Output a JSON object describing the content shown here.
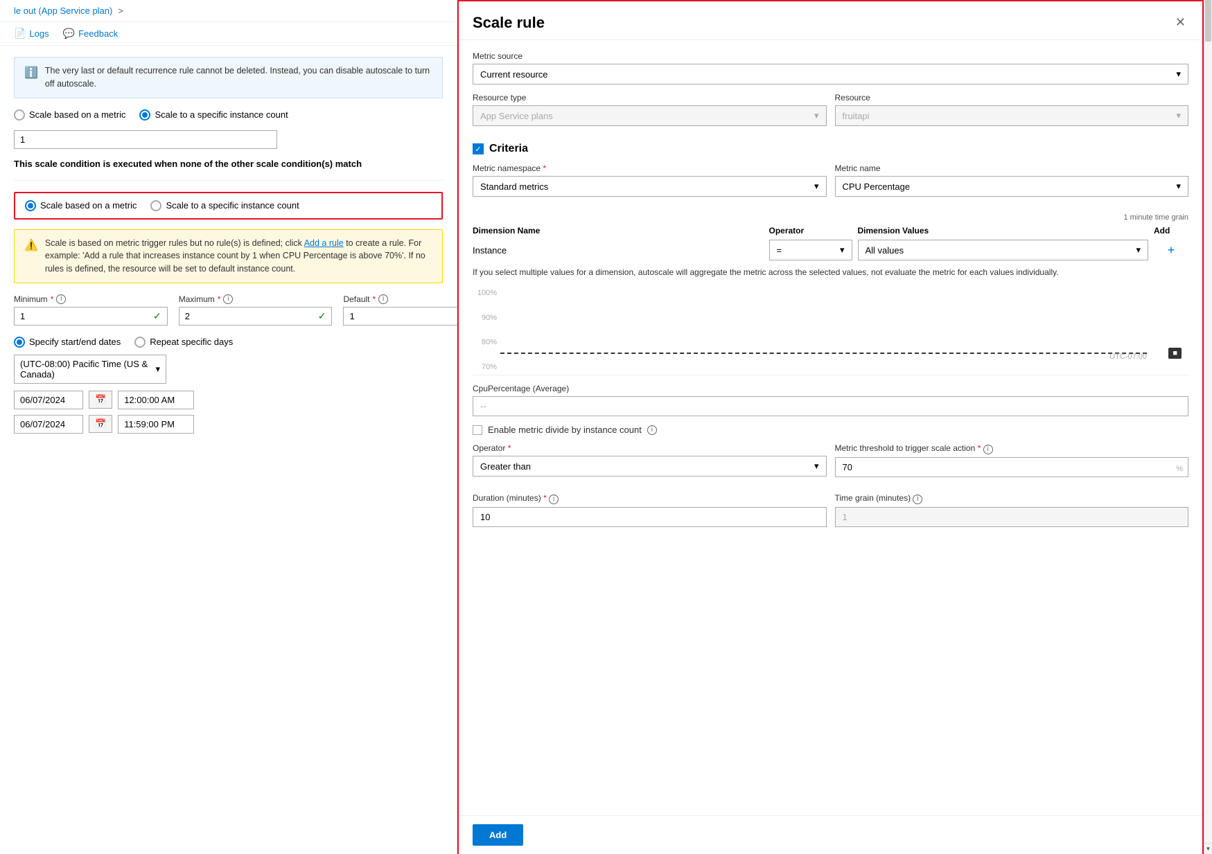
{
  "breadcrumb": {
    "link_text": "le out (App Service plan)",
    "separator": ">"
  },
  "toolbar": {
    "logs_label": "Logs",
    "feedback_label": "Feedback",
    "feedback_icon": "💬"
  },
  "info_box": {
    "text": "The very last or default recurrence rule cannot be deleted. Instead, you can disable autoscale to turn off autoscale."
  },
  "section1": {
    "radio1_label": "Scale based on a metric",
    "radio2_label": "Scale to a specific instance count",
    "radio2_selected": true,
    "instance_value": "1",
    "condition_text": "This scale condition is executed when none of the other scale condition(s) match"
  },
  "section2": {
    "radio1_label": "Scale based on a metric",
    "radio1_selected": true,
    "radio2_label": "Scale to a specific instance count",
    "warning_text_before": "Scale is based on metric trigger rules but no rule(s) is defined; click",
    "warning_link": "Add a rule",
    "warning_text_after": "to create a rule. For example: 'Add a rule that increases instance count by 1 when CPU Percentage is above 70%'. If no rules is defined, the resource will be set to default instance count.",
    "minimum_label": "Minimum",
    "minimum_value": "1",
    "maximum_label": "Maximum",
    "maximum_value": "2",
    "default_label": "Default",
    "default_value": "1"
  },
  "date_section": {
    "option1_label": "Specify start/end dates",
    "option1_selected": true,
    "option2_label": "Repeat specific days",
    "timezone_value": "(UTC-08:00) Pacific Time (US & Canada)",
    "start_date": "06/07/2024",
    "start_time": "12:00:00 AM",
    "end_date": "06/07/2024",
    "end_time": "11:59:00 PM"
  },
  "scale_rule_panel": {
    "title": "Scale rule",
    "close_icon": "✕",
    "metric_source_label": "Metric source",
    "metric_source_value": "Current resource",
    "resource_type_label": "Resource type",
    "resource_type_value": "App Service plans",
    "resource_label": "Resource",
    "resource_value": "fruitapi",
    "criteria_label": "Criteria",
    "metric_namespace_label": "Metric namespace",
    "metric_namespace_required": true,
    "metric_namespace_value": "Standard metrics",
    "metric_name_label": "Metric name",
    "metric_name_value": "CPU Percentage",
    "time_grain_label": "1 minute time grain",
    "dimension_name_header": "Dimension Name",
    "operator_header": "Operator",
    "dimension_values_header": "Dimension Values",
    "add_header": "Add",
    "dimension_name_value": "Instance",
    "dimension_operator_value": "=",
    "dimension_values_value": "All values",
    "dimension_note": "If you select multiple values for a dimension, autoscale will aggregate the metric across the selected values, not evaluate the metric for each values individually.",
    "chart_labels": [
      "100%",
      "90%",
      "80%",
      "70%"
    ],
    "chart_threshold_value": "70%",
    "chart_time": "UTC-07:00",
    "metric_display_label": "CpuPercentage (Average)",
    "metric_display_value": "--",
    "enable_metric_divide_label": "Enable metric divide by instance count",
    "operator_label": "Operator",
    "operator_required": true,
    "operator_value": "Greater than",
    "threshold_label": "Metric threshold to trigger scale action",
    "threshold_required": true,
    "threshold_value": "70",
    "threshold_suffix": "%",
    "duration_label": "Duration (minutes)",
    "duration_required": true,
    "duration_value": "10",
    "time_grain_minutes_label": "Time grain (minutes)",
    "time_grain_minutes_value": "1",
    "add_button_label": "Add"
  }
}
